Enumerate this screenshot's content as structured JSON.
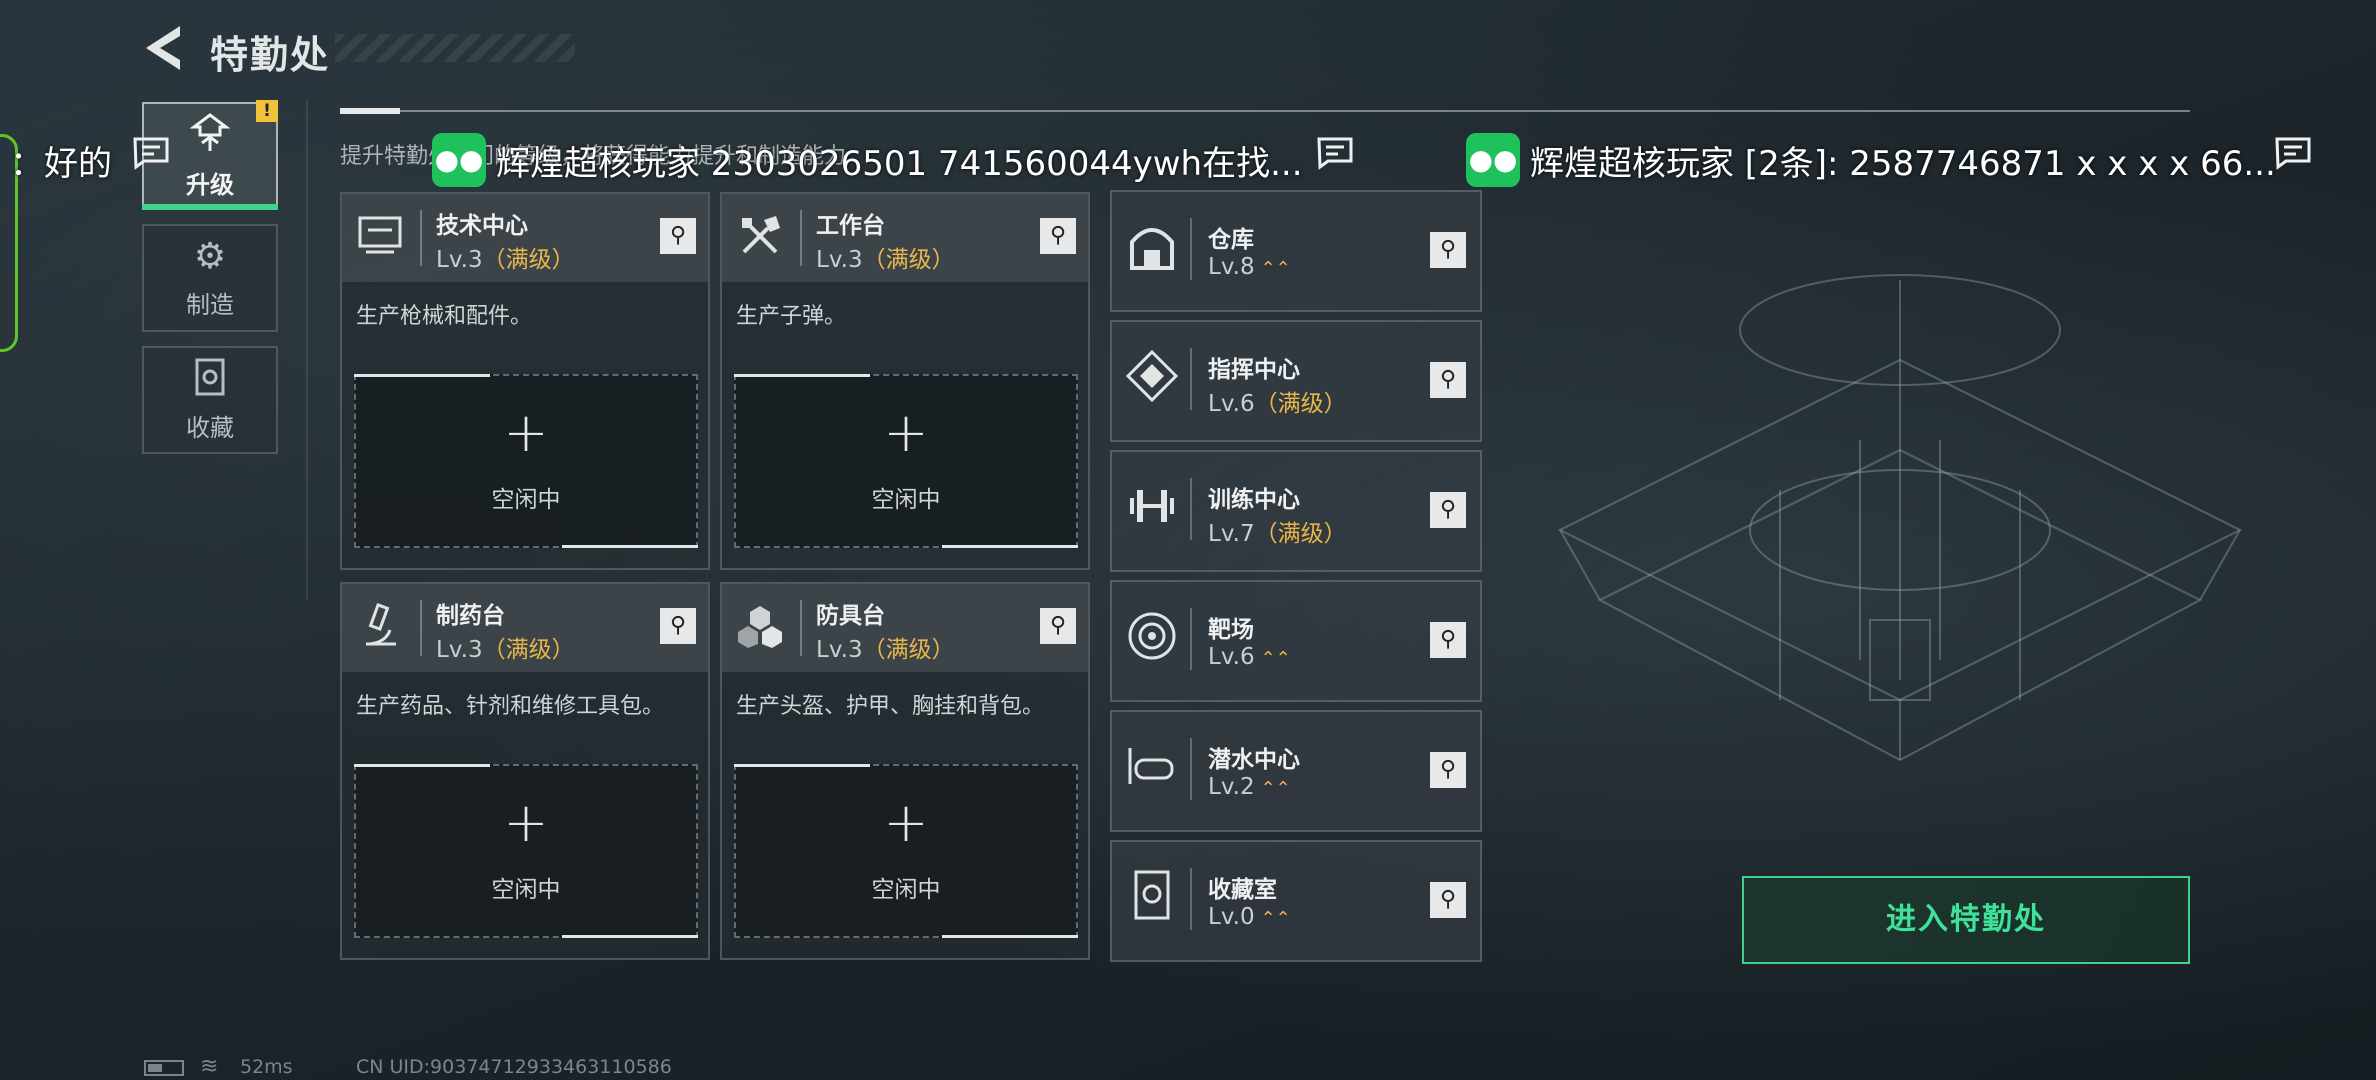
{
  "header": {
    "title": "特勤处"
  },
  "tabs": [
    {
      "label": "升级",
      "icon": "upgrade-icon",
      "active": true
    },
    {
      "label": "制造",
      "icon": "gear-icon",
      "active": false
    },
    {
      "label": "收藏",
      "icon": "collection-icon",
      "active": false
    }
  ],
  "alert_badge": "!",
  "subtitle": "提升特勤处部门的等级，将获得能力提升和制造能力",
  "cards": [
    {
      "name": "技术中心",
      "level": "Lv.3",
      "maxed": "（满级）",
      "desc": "生产枪械和配件。",
      "slot_plus": "+",
      "slot_label": "空闲中",
      "icon": "computer-icon"
    },
    {
      "name": "工作台",
      "level": "Lv.3",
      "maxed": "（满级）",
      "desc": "生产子弹。",
      "slot_plus": "+",
      "slot_label": "空闲中",
      "icon": "tools-icon"
    },
    {
      "name": "制药台",
      "level": "Lv.3",
      "maxed": "（满级）",
      "desc": "生产药品、针剂和维修工具包。",
      "slot_plus": "+",
      "slot_label": "空闲中",
      "icon": "microscope-icon"
    },
    {
      "name": "防具台",
      "level": "Lv.3",
      "maxed": "（满级）",
      "desc": "生产头盔、护甲、胸挂和背包。",
      "slot_plus": "+",
      "slot_label": "空闲中",
      "icon": "cubes-icon"
    }
  ],
  "facilities": [
    {
      "name": "仓库",
      "level": "Lv.8",
      "maxed": "",
      "up": "⌃⌃",
      "icon": "warehouse-icon"
    },
    {
      "name": "指挥中心",
      "level": "Lv.6",
      "maxed": "（满级）",
      "up": "",
      "icon": "command-icon"
    },
    {
      "name": "训练中心",
      "level": "Lv.7",
      "maxed": "（满级）",
      "up": "",
      "icon": "dumbbell-icon"
    },
    {
      "name": "靶场",
      "level": "Lv.6",
      "maxed": "",
      "up": "⌃⌃",
      "icon": "target-icon"
    },
    {
      "name": "潜水中心",
      "level": "Lv.2",
      "maxed": "",
      "up": "⌃⌃",
      "icon": "diving-mask-icon"
    },
    {
      "name": "收藏室",
      "level": "Lv.0",
      "maxed": "",
      "up": "⌃⌃",
      "icon": "vault-icon"
    }
  ],
  "enter_button": "进入特勤处",
  "status": {
    "ping": "52ms",
    "uid": "CN UID:90374712933463110586"
  },
  "notifications": {
    "left": "：好的",
    "center": "辉煌超核玩家 2303026501  741560044ywh在找...",
    "right": "辉煌超核玩家 [2条]: 2587746871 x x x x 66..."
  },
  "colors": {
    "accent_green": "#3fd28a",
    "maxed_gold": "#e9b64a",
    "wechat_green": "#1fc25a"
  }
}
